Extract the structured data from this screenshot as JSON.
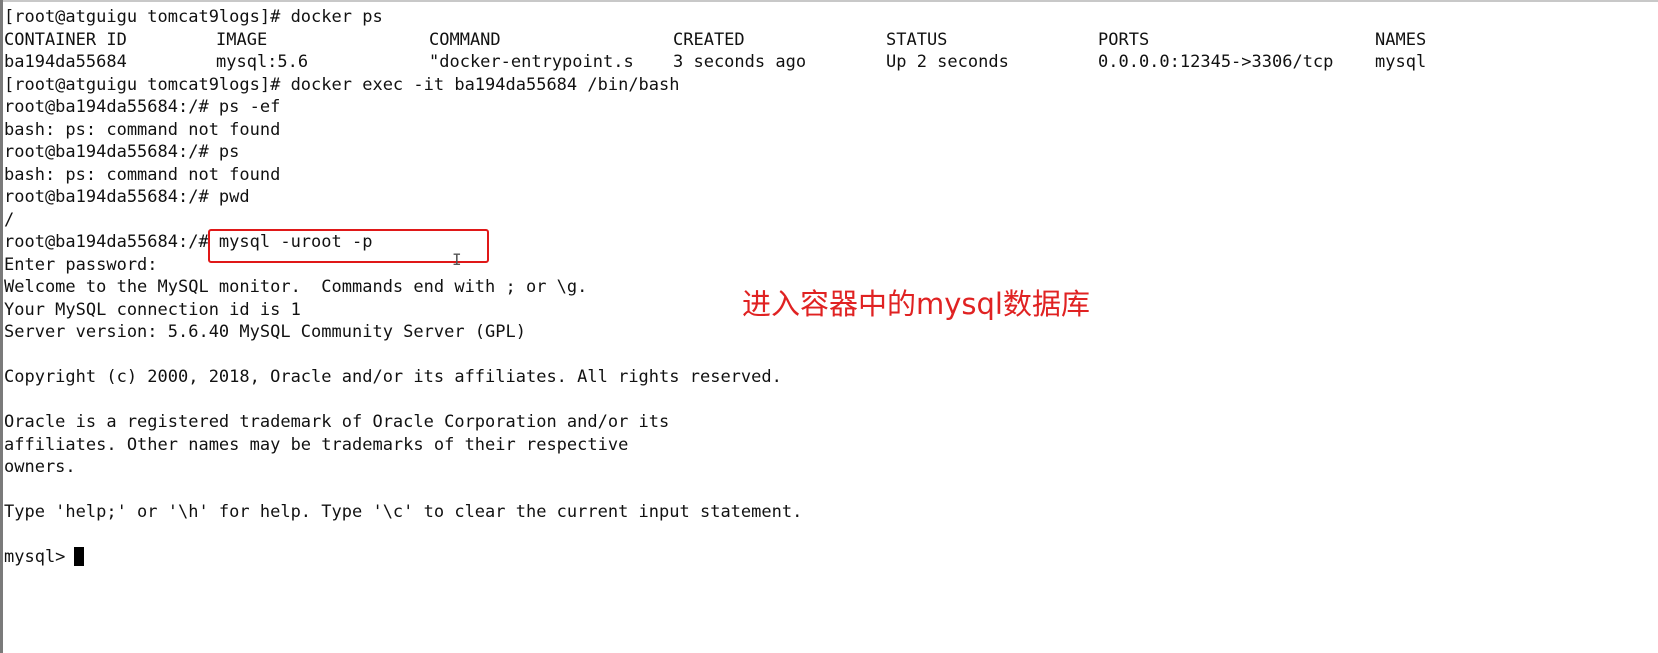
{
  "terminal": {
    "lines": {
      "l0": "[root@atguigu tomcat9logs]# docker ps",
      "l3": "[root@atguigu tomcat9logs]# docker exec -it ba194da55684 /bin/bash",
      "l4": "root@ba194da55684:/# ps -ef",
      "l5": "bash: ps: command not found",
      "l6": "root@ba194da55684:/# ps",
      "l7": "bash: ps: command not found",
      "l8": "root@ba194da55684:/# pwd",
      "l9": "/",
      "l10": "root@ba194da55684:/# mysql -uroot -p",
      "l11": "Enter password:",
      "l12": "Welcome to the MySQL monitor.  Commands end with ; or \\g.",
      "l13": "Your MySQL connection id is 1",
      "l14": "Server version: 5.6.40 MySQL Community Server (GPL)",
      "l15": "",
      "l16": "Copyright (c) 2000, 2018, Oracle and/or its affiliates. All rights reserved.",
      "l17": "",
      "l18": "Oracle is a registered trademark of Oracle Corporation and/or its",
      "l19": "affiliates. Other names may be trademarks of their respective",
      "l20": "owners.",
      "l21": "",
      "l22": "Type 'help;' or '\\h' for help. Type '\\c' to clear the current input statement.",
      "l23": "",
      "l24": "mysql>"
    },
    "docker_table": {
      "headers": {
        "container_id": "CONTAINER ID",
        "image": "IMAGE",
        "command": "COMMAND",
        "created": "CREATED",
        "status": "STATUS",
        "ports": "PORTS",
        "names": "NAMES"
      },
      "row": {
        "container_id": "ba194da55684",
        "image": "mysql:5.6",
        "command": "\"docker-entrypoint.s",
        "created": "3 seconds ago",
        "status": "Up 2 seconds",
        "ports": "0.0.0.0:12345->3306/tcp",
        "names": "mysql"
      }
    }
  },
  "annotation": {
    "text": "进入容器中的mysql数据库",
    "color": "#e02222"
  },
  "highlight": {
    "color": "#e01818"
  },
  "cursor_glyph": "I"
}
